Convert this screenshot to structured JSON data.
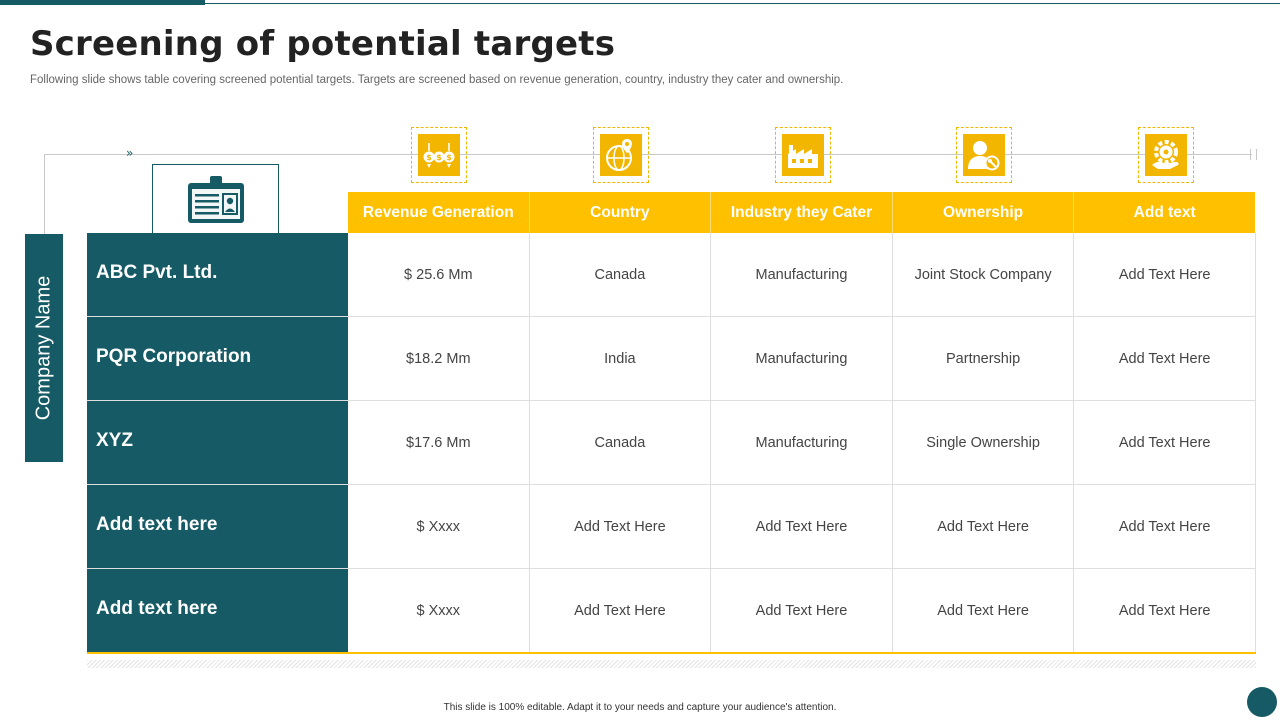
{
  "title": "Screening of potential targets",
  "subtitle": "Following slide shows table covering screened potential targets. Targets are screened based on revenue generation, country, industry they cater and ownership.",
  "side_label": "Company Name",
  "connector_arrows": "»",
  "icons": [
    "money-exchange-icon",
    "globe-location-icon",
    "factory-icon",
    "user-key-icon",
    "gear-hand-icon"
  ],
  "id_card_icon": "id-card-icon",
  "columns": [
    "Revenue Generation",
    "Country",
    "Industry they Cater",
    "Ownership",
    "Add text"
  ],
  "rows": [
    {
      "name": "ABC Pvt. Ltd.",
      "cells": [
        "$ 25.6 Mm",
        "Canada",
        "Manufacturing",
        "Joint Stock Company",
        "Add Text Here"
      ]
    },
    {
      "name": "PQR Corporation",
      "cells": [
        "$18.2 Mm",
        "India",
        "Manufacturing",
        "Partnership",
        "Add Text Here"
      ]
    },
    {
      "name": "XYZ",
      "cells": [
        "$17.6 Mm",
        "Canada",
        "Manufacturing",
        "Single Ownership",
        "Add Text Here"
      ]
    },
    {
      "name": "Add text here",
      "cells": [
        "$ Xxxx",
        "Add Text Here",
        "Add Text Here",
        "Add Text Here",
        "Add Text Here"
      ]
    },
    {
      "name": "Add text here",
      "cells": [
        "$ Xxxx",
        "Add Text Here",
        "Add Text Here",
        "Add Text Here",
        "Add Text Here"
      ]
    }
  ],
  "footer": "This slide is 100% editable. Adapt it to your needs and capture your audience's attention.",
  "colors": {
    "teal": "#155a64",
    "yellow": "#ffc000",
    "grid": "#dedede"
  }
}
